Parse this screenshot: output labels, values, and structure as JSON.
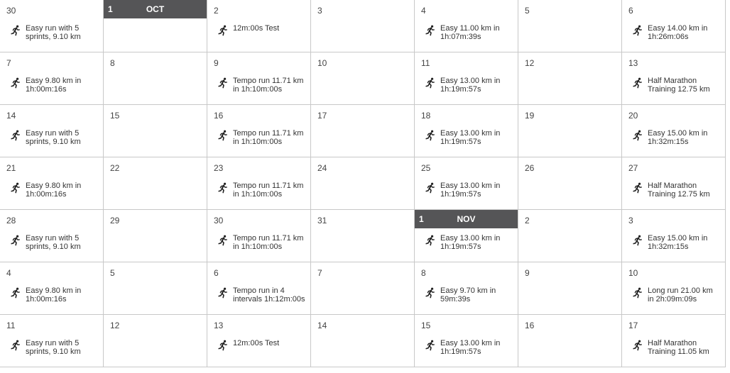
{
  "calendar": {
    "weeks": [
      [
        {
          "day": "30",
          "workout": "Easy run with 5 sprints, 9.10 km"
        },
        {
          "day": "1",
          "month": "OCT",
          "workout": ""
        },
        {
          "day": "2",
          "workout": "12m:00s Test"
        },
        {
          "day": "3",
          "workout": ""
        },
        {
          "day": "4",
          "workout": "Easy 11.00 km in 1h:07m:39s"
        },
        {
          "day": "5",
          "workout": ""
        },
        {
          "day": "6",
          "workout": "Easy 14.00 km in 1h:26m:06s"
        }
      ],
      [
        {
          "day": "7",
          "workout": "Easy 9.80 km in 1h:00m:16s"
        },
        {
          "day": "8",
          "workout": ""
        },
        {
          "day": "9",
          "workout": "Tempo run 11.71 km in 1h:10m:00s"
        },
        {
          "day": "10",
          "workout": ""
        },
        {
          "day": "11",
          "workout": "Easy 13.00 km in 1h:19m:57s"
        },
        {
          "day": "12",
          "workout": ""
        },
        {
          "day": "13",
          "workout": "Half Marathon Training 12.75 km"
        }
      ],
      [
        {
          "day": "14",
          "workout": "Easy run with 5 sprints, 9.10 km"
        },
        {
          "day": "15",
          "workout": ""
        },
        {
          "day": "16",
          "workout": "Tempo run 11.71 km in 1h:10m:00s"
        },
        {
          "day": "17",
          "workout": ""
        },
        {
          "day": "18",
          "workout": "Easy 13.00 km in 1h:19m:57s"
        },
        {
          "day": "19",
          "workout": ""
        },
        {
          "day": "20",
          "workout": "Easy 15.00 km in 1h:32m:15s"
        }
      ],
      [
        {
          "day": "21",
          "workout": "Easy 9.80 km in 1h:00m:16s"
        },
        {
          "day": "22",
          "workout": ""
        },
        {
          "day": "23",
          "workout": "Tempo run 11.71 km in 1h:10m:00s"
        },
        {
          "day": "24",
          "workout": ""
        },
        {
          "day": "25",
          "workout": "Easy 13.00 km in 1h:19m:57s"
        },
        {
          "day": "26",
          "workout": ""
        },
        {
          "day": "27",
          "workout": "Half Marathon Training 12.75 km"
        }
      ],
      [
        {
          "day": "28",
          "workout": "Easy run with 5 sprints, 9.10 km"
        },
        {
          "day": "29",
          "workout": ""
        },
        {
          "day": "30",
          "workout": "Tempo run 11.71 km in 1h:10m:00s"
        },
        {
          "day": "31",
          "workout": ""
        },
        {
          "day": "1",
          "month": "NOV",
          "workout": "Easy 13.00 km in 1h:19m:57s"
        },
        {
          "day": "2",
          "workout": ""
        },
        {
          "day": "3",
          "workout": "Easy 15.00 km in 1h:32m:15s"
        }
      ],
      [
        {
          "day": "4",
          "workout": "Easy 9.80 km in 1h:00m:16s"
        },
        {
          "day": "5",
          "workout": ""
        },
        {
          "day": "6",
          "workout": "Tempo run in 4 intervals 1h:12m:00s"
        },
        {
          "day": "7",
          "workout": ""
        },
        {
          "day": "8",
          "workout": "Easy 9.70 km in 59m:39s"
        },
        {
          "day": "9",
          "workout": ""
        },
        {
          "day": "10",
          "workout": "Long run 21.00 km in 2h:09m:09s"
        }
      ],
      [
        {
          "day": "11",
          "workout": "Easy run with 5 sprints, 9.10 km"
        },
        {
          "day": "12",
          "workout": ""
        },
        {
          "day": "13",
          "workout": "12m:00s Test"
        },
        {
          "day": "14",
          "workout": ""
        },
        {
          "day": "15",
          "workout": "Easy 13.00 km in 1h:19m:57s"
        },
        {
          "day": "16",
          "workout": ""
        },
        {
          "day": "17",
          "workout": "Half Marathon Training 11.05 km"
        }
      ]
    ]
  },
  "icons": {
    "workout": "runner-icon"
  },
  "colors": {
    "month_header_bg": "#555557",
    "grid_line": "#c8c8c8"
  }
}
